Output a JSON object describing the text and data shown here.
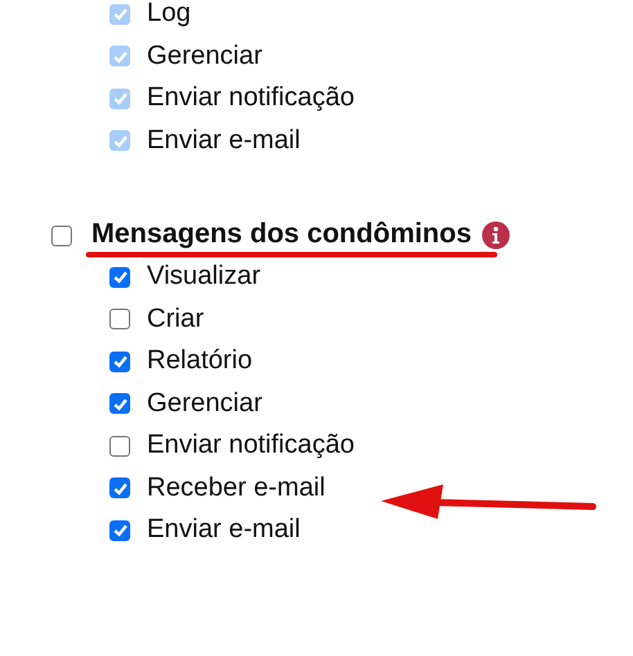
{
  "sections": [
    {
      "items": [
        {
          "label": "Log",
          "checked": true,
          "disabled": true
        },
        {
          "label": "Gerenciar",
          "checked": true,
          "disabled": true
        },
        {
          "label": "Enviar notificação",
          "checked": true,
          "disabled": true
        },
        {
          "label": "Enviar e-mail",
          "checked": true,
          "disabled": true
        }
      ]
    },
    {
      "title": "Mensagens dos condôminos",
      "checked": false,
      "items": [
        {
          "label": "Visualizar",
          "checked": true,
          "disabled": false
        },
        {
          "label": "Criar",
          "checked": false,
          "disabled": false
        },
        {
          "label": "Relatório",
          "checked": true,
          "disabled": false
        },
        {
          "label": "Gerenciar",
          "checked": true,
          "disabled": false
        },
        {
          "label": "Enviar notificação",
          "checked": false,
          "disabled": false
        },
        {
          "label": "Receber e-mail",
          "checked": true,
          "disabled": false
        },
        {
          "label": "Enviar e-mail",
          "checked": true,
          "disabled": false
        }
      ]
    }
  ]
}
